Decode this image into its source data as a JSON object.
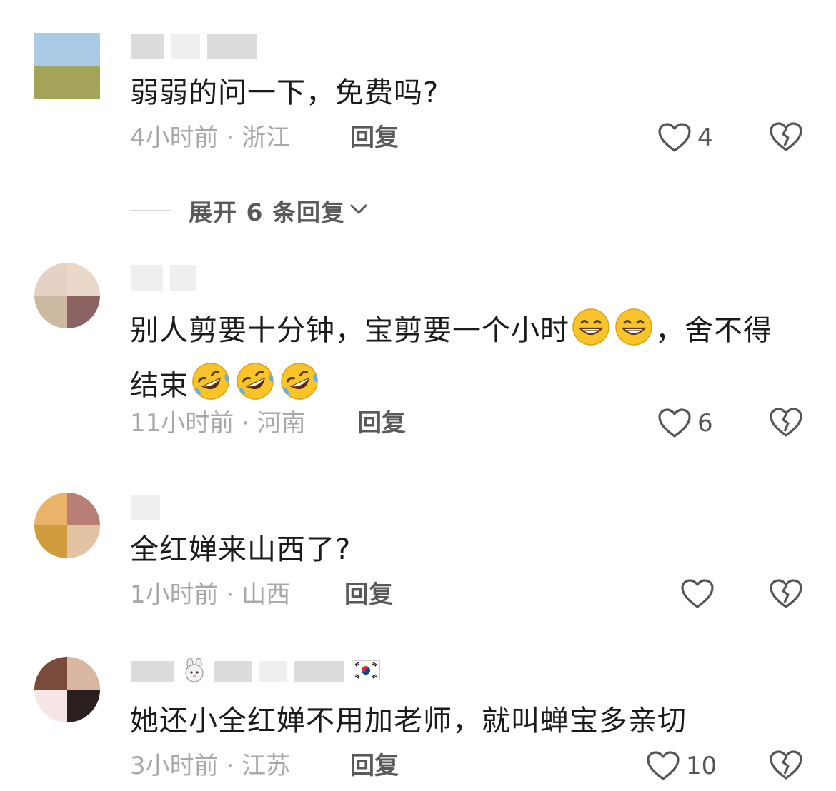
{
  "comments": [
    {
      "text": "弱弱的问一下，免费吗?",
      "time": "4小时前",
      "location": "浙江",
      "reply_label": "回复",
      "likes": "4",
      "avatar_colors": [
        "#a9cbe5",
        "#a9cbe5",
        "#a3a35a",
        "#a3a35a"
      ]
    },
    {
      "text": "别人剪要十分钟，宝剪要一个小时",
      "text_end": "，舍不得结束",
      "time": "11小时前",
      "location": "河南",
      "reply_label": "回复",
      "likes": "6",
      "avatar_colors": [
        "#e6d2c4",
        "#ead9cb",
        "#cdb8a2",
        "#8d6262"
      ]
    },
    {
      "text": "全红婵来山西了?",
      "time": "1小时前",
      "location": "山西",
      "reply_label": "回复",
      "likes": "",
      "avatar_colors": [
        "#e9b46a",
        "#b97e76",
        "#cf9b3c",
        "#e2c3a4"
      ]
    },
    {
      "text": "她还小全红婵不用加老师，就叫蝉宝多亲切",
      "time": "3小时前",
      "location": "江苏",
      "reply_label": "回复",
      "likes": "10",
      "avatar_colors": [
        "#7a4a3a",
        "#d8b6a2",
        "#f6e6e6",
        "#2a2020"
      ]
    }
  ],
  "expand_replies": {
    "label": "展开 6 条回复"
  },
  "icons": {
    "like": "heart-outline-icon",
    "dislike": "broken-heart-icon",
    "expand": "chevron-down-icon",
    "grin_emoji": "grinning-face-emoji",
    "laugh_cry_emoji": "rolling-on-floor-laughing-emoji",
    "rabbit_emoji": "rabbit-face-emoji",
    "flag": "korea-flag-icon"
  },
  "colors": {
    "meta_gray": "#a8a8a8",
    "reply_gray": "#5a5a5a",
    "text": "#1a1a1a"
  }
}
